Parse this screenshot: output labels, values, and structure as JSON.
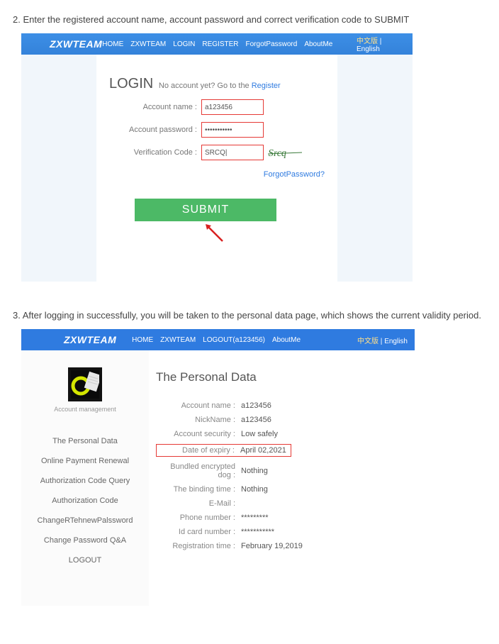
{
  "step2": "2. Enter the registered account name, account password and correct verification code to SUBMIT",
  "step3": "3. After logging in successfully, you will be taken to the personal data page, which shows the current validity period.",
  "brand": "ZXWTEAM",
  "nav1": {
    "home": "HOME",
    "zxw": "ZXWTEAM",
    "login": "LOGIN",
    "register": "REGISTER",
    "forgot": "ForgotPassword",
    "about": "AboutMe"
  },
  "lang": {
    "cn": "中文版",
    "sep": " | ",
    "en": "English"
  },
  "login": {
    "title": "LOGIN",
    "sub_pre": "No account yet? Go to the ",
    "sub_link": "Register",
    "account_label": "Account name :",
    "account_value": "a123456",
    "password_label": "Account password :",
    "password_value": "•••••••••••",
    "vcode_label": "Verification Code :",
    "vcode_value": "SRCQ|",
    "captcha_text": "Srcq",
    "forgot": "ForgotPassword?",
    "submit": "SUBMIT"
  },
  "nav2": {
    "home": "HOME",
    "zxw": "ZXWTEAM",
    "logout": "LOGOUT(a123456)",
    "about": "AboutMe"
  },
  "sidebar": {
    "mgmt": "Account management",
    "items": [
      "The Personal Data",
      "Online Payment Renewal",
      "Authorization Code Query",
      "Authorization Code",
      "ChangeRTehnewPalssword",
      "Change Password Q&A",
      "LOGOUT"
    ]
  },
  "pd": {
    "title": "The Personal Data",
    "rows": {
      "account": {
        "label": "Account name :",
        "value": "a123456"
      },
      "nick": {
        "label": "NickName :",
        "value": "a123456"
      },
      "sec": {
        "label": "Account security :",
        "value": "Low safely"
      },
      "expiry": {
        "label": "Date of expiry :",
        "value": "April 02,2021"
      },
      "dog": {
        "label": "Bundled encrypted dog :",
        "value": "Nothing"
      },
      "bind": {
        "label": "The binding time :",
        "value": "Nothing"
      },
      "email": {
        "label": "E-Mail :",
        "value": ""
      },
      "phone": {
        "label": "Phone number :",
        "value": "*********"
      },
      "idcard": {
        "label": "Id card number :",
        "value": "***********"
      },
      "reg": {
        "label": "Registration time :",
        "value": "February 19,2019"
      }
    }
  }
}
